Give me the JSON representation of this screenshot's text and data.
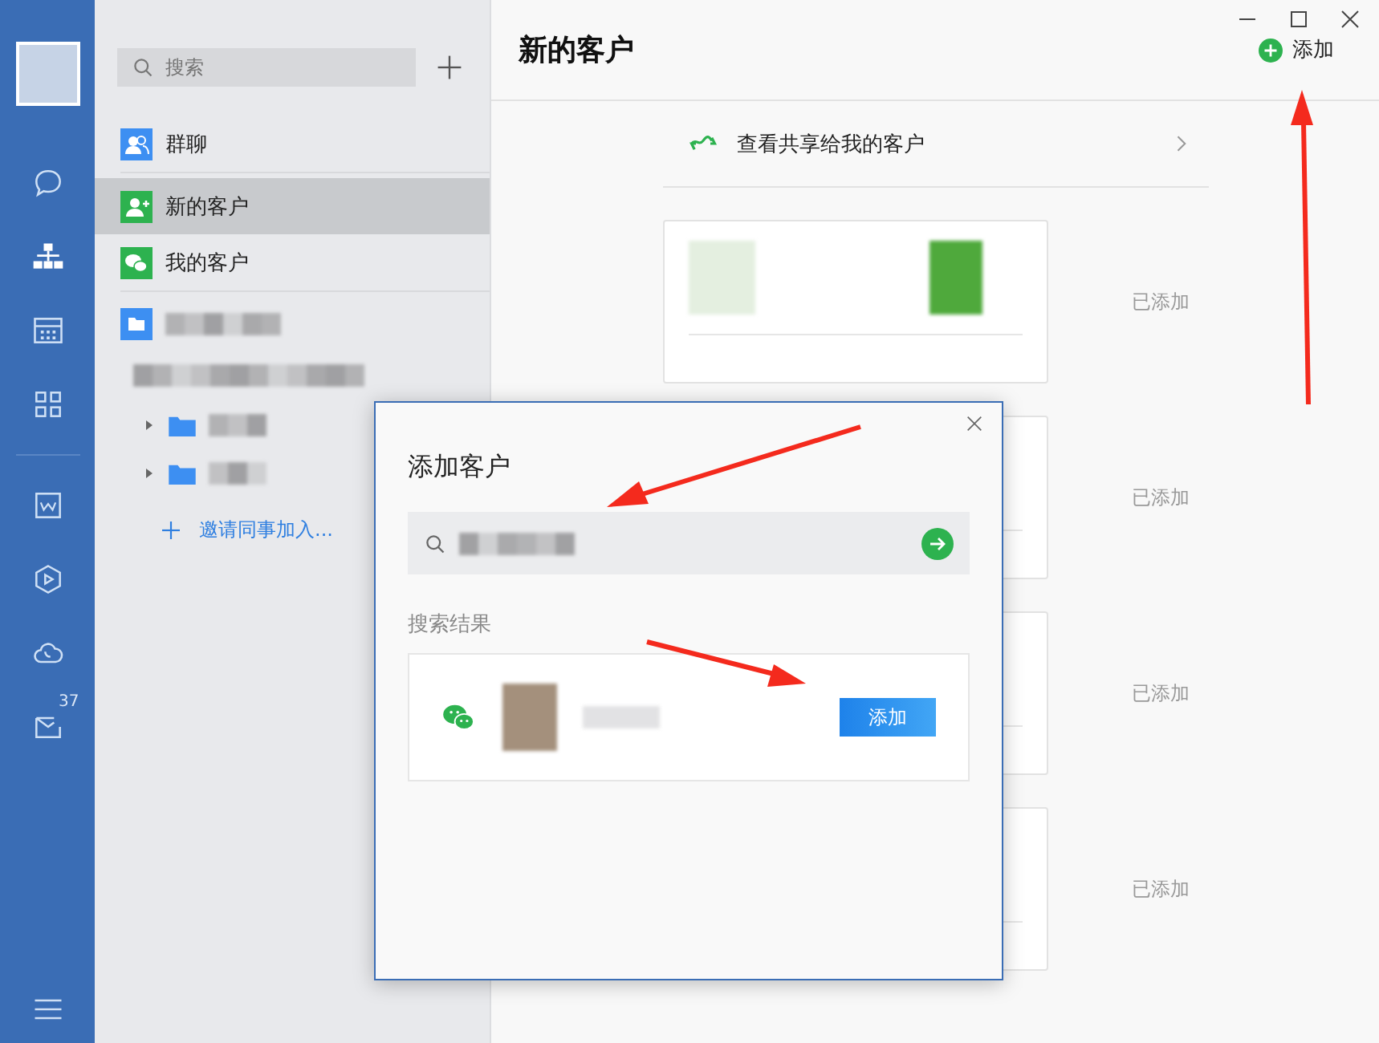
{
  "rail": {
    "mail_badge": "37"
  },
  "sidebar": {
    "search": {
      "placeholder": "搜索"
    },
    "items": [
      {
        "kind": "group",
        "label": "群聊",
        "selected": false
      },
      {
        "kind": "new",
        "label": "新的客户",
        "selected": true
      },
      {
        "kind": "wechat",
        "label": "我的客户",
        "selected": false
      }
    ],
    "tree": {
      "children": [
        {
          "expanded": false
        },
        {
          "expanded": false
        }
      ]
    },
    "invite": "邀请同事加入..."
  },
  "header": {
    "title": "新的客户",
    "add_button": "添加"
  },
  "shared_link": "查看共享给我的客户",
  "customers": [
    {
      "status": "已添加"
    },
    {
      "status": "已添加"
    },
    {
      "status": "已添加"
    },
    {
      "status": "已添加"
    }
  ],
  "dialog": {
    "title": "添加客户",
    "section_label": "搜索结果",
    "result": {
      "button": "添加"
    }
  }
}
